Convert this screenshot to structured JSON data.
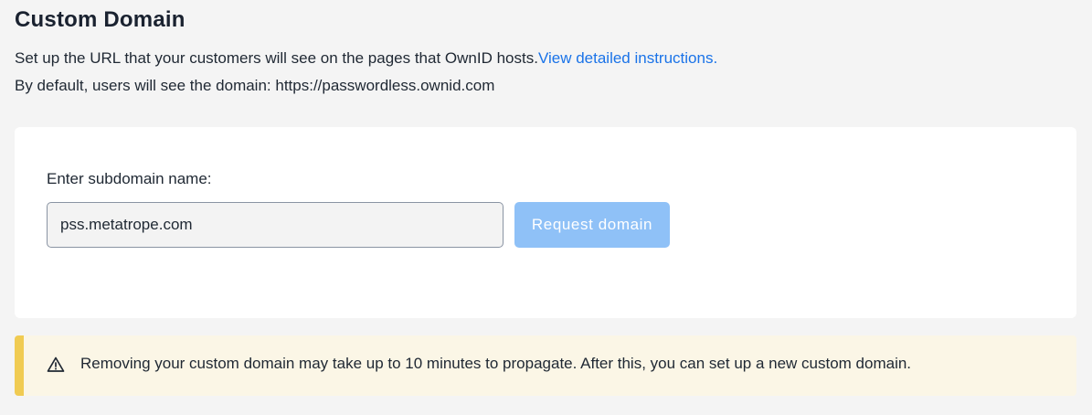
{
  "page": {
    "title": "Custom Domain",
    "description_text": "Set up the URL that your customers will see on the pages that OwnID hosts.",
    "instructions_link": "View detailed instructions.",
    "default_domain_text": "By default, users will see the domain: https://passwordless.ownid.com"
  },
  "form": {
    "subdomain_label": "Enter subdomain name:",
    "subdomain_value": "pss.metatrope.com",
    "request_button": "Request domain",
    "request_button_state": "disabled"
  },
  "alert": {
    "icon": "warning-triangle-icon",
    "message": "Removing your custom domain may take up to 10 minutes to propagate. After this, you can set up a new custom domain.",
    "accent_color": "#f0cb52"
  },
  "colors": {
    "link": "#1a73e8",
    "button_disabled": "#8fc1f7",
    "background": "#f4f4f4"
  }
}
